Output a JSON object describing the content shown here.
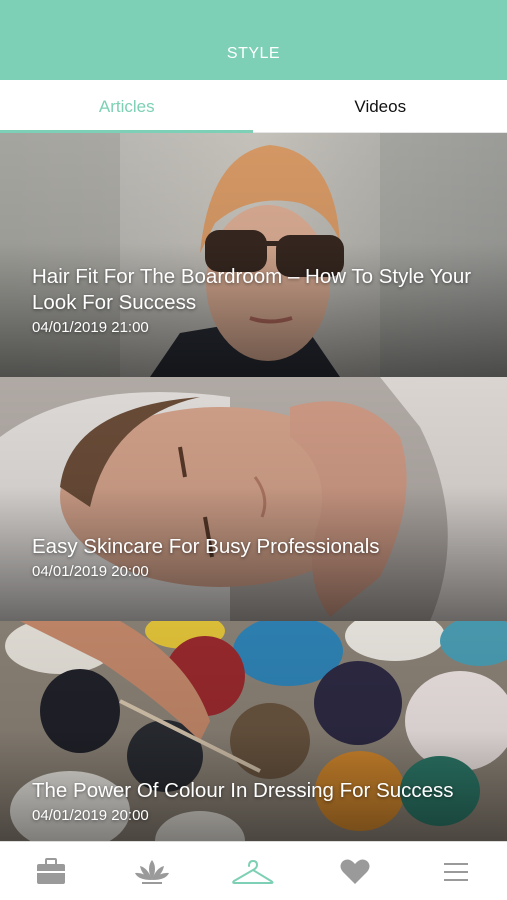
{
  "header": {
    "title": "STYLE"
  },
  "tabs": [
    {
      "label": "Articles",
      "active": true
    },
    {
      "label": "Videos",
      "active": false
    }
  ],
  "articles": [
    {
      "title": "Hair Fit For The Boardroom – How To Style Your Look For Success",
      "date": "04/01/2019 21:00"
    },
    {
      "title": "Easy Skincare For Busy Professionals",
      "date": "04/01/2019 20:00"
    },
    {
      "title": "The Power Of Colour In Dressing For Success",
      "date": "04/01/2019 20:00"
    }
  ],
  "bottom_nav": [
    {
      "icon": "briefcase-icon",
      "active": false
    },
    {
      "icon": "lotus-icon",
      "active": false
    },
    {
      "icon": "hanger-icon",
      "active": true
    },
    {
      "icon": "heart-icon",
      "active": false
    },
    {
      "icon": "menu-icon",
      "active": false
    }
  ],
  "colors": {
    "accent": "#7dd0b5",
    "inactive_icon": "#9a9a9a",
    "tab_text": "#111111"
  }
}
